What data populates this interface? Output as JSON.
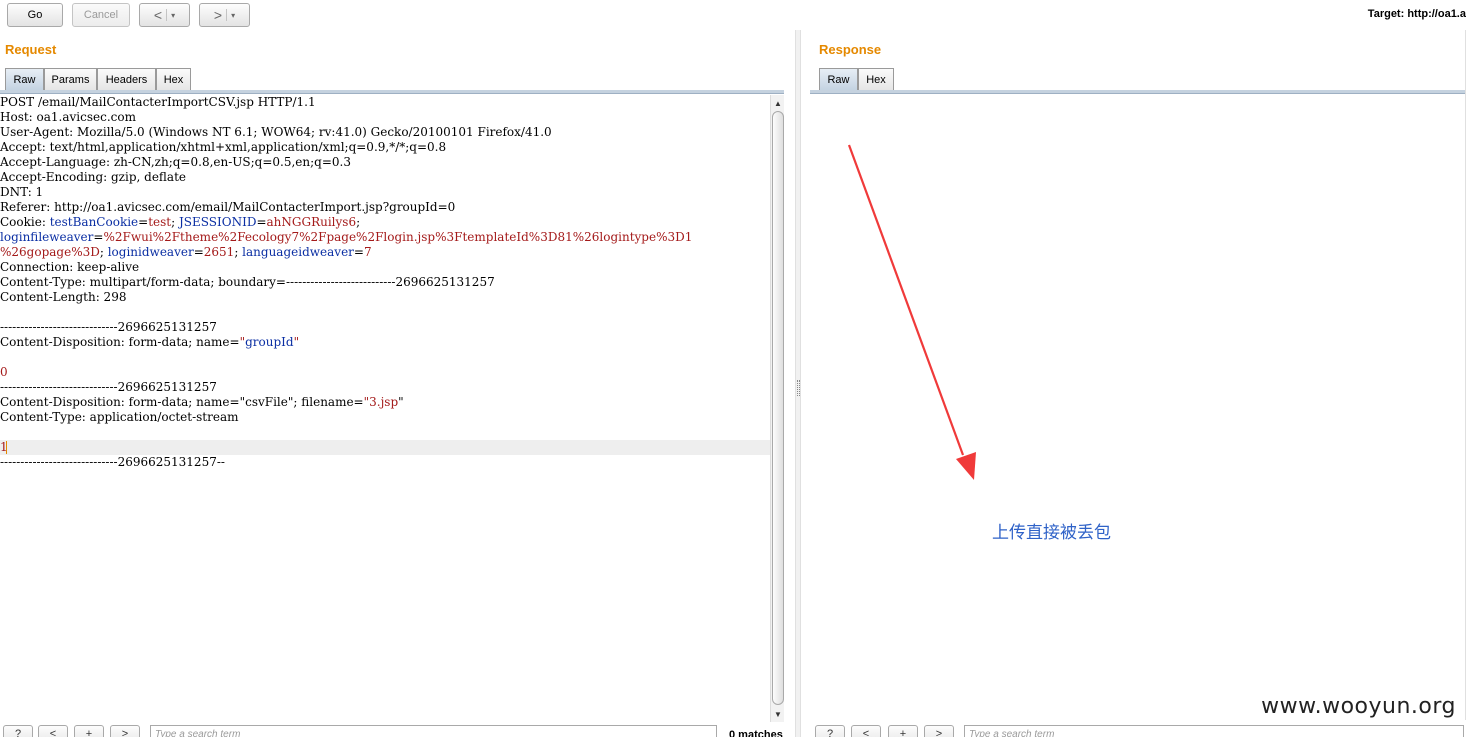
{
  "toolbar": {
    "go_label": "Go",
    "cancel_label": "Cancel",
    "back_glyph": "<",
    "forward_glyph": ">",
    "dropdown_glyph": "▾",
    "target_text": "Target: http://oa1.a"
  },
  "request": {
    "title": "Request",
    "tabs": [
      "Raw",
      "Params",
      "Headers",
      "Hex"
    ],
    "active_tab": "Raw",
    "lines": [
      [
        {
          "t": "POST /email/MailContacterImportCSV.jsp HTTP/1.1"
        }
      ],
      [
        {
          "t": "Host: oa1.avicsec.com"
        }
      ],
      [
        {
          "t": "User-Agent: Mozilla/5.0 (Windows NT 6.1; WOW64; rv:41.0) Gecko/20100101 Firefox/41.0"
        }
      ],
      [
        {
          "t": "Accept: text/html,application/xhtml+xml,application/xml;q=0.9,*/*;q=0.8"
        }
      ],
      [
        {
          "t": "Accept-Language: zh-CN,zh;q=0.8,en-US;q=0.5,en;q=0.3"
        }
      ],
      [
        {
          "t": "Accept-Encoding: gzip, deflate"
        }
      ],
      [
        {
          "t": "DNT: 1"
        }
      ],
      [
        {
          "t": "Referer: http://oa1.avicsec.com/email/MailContacterImport.jsp?groupId=0"
        }
      ],
      [
        {
          "t": "Cookie: "
        },
        {
          "t": "testBanCookie",
          "c": "k"
        },
        {
          "t": "="
        },
        {
          "t": "test",
          "c": "v"
        },
        {
          "t": "; "
        },
        {
          "t": "JSESSIONID",
          "c": "k"
        },
        {
          "t": "="
        },
        {
          "t": "ahNGGRuilys6",
          "c": "v"
        },
        {
          "t": ";"
        }
      ],
      [
        {
          "t": "loginfileweaver",
          "c": "k"
        },
        {
          "t": "="
        },
        {
          "t": "%2Fwui%2Ftheme%2Fecology7%2Fpage%2Flogin.jsp%3FtemplateId%3D81%26logintype%3D1",
          "c": "v"
        }
      ],
      [
        {
          "t": "%26gopage%3D",
          "c": "v"
        },
        {
          "t": "; "
        },
        {
          "t": "loginidweaver",
          "c": "k"
        },
        {
          "t": "="
        },
        {
          "t": "2651",
          "c": "v"
        },
        {
          "t": "; "
        },
        {
          "t": "languageidweaver",
          "c": "k"
        },
        {
          "t": "="
        },
        {
          "t": "7",
          "c": "v"
        }
      ],
      [
        {
          "t": "Connection: keep-alive"
        }
      ],
      [
        {
          "t": "Content-Type: multipart/form-data; boundary=---------------------------2696625131257"
        }
      ],
      [
        {
          "t": "Content-Length: 298"
        }
      ],
      [
        {
          "t": ""
        }
      ],
      [
        {
          "t": "-----------------------------2696625131257"
        }
      ],
      [
        {
          "t": "Content-Disposition: form-data; name="
        },
        {
          "t": "\"",
          "c": "v"
        },
        {
          "t": "groupId",
          "c": "k"
        },
        {
          "t": "\"",
          "c": "v"
        }
      ],
      [
        {
          "t": ""
        }
      ],
      [
        {
          "t": "0",
          "c": "v"
        }
      ],
      [
        {
          "t": "-----------------------------2696625131257"
        }
      ],
      [
        {
          "t": "Content-Disposition: form-data; name="
        },
        {
          "t": "\"csvFile\""
        },
        {
          "t": "; filename="
        },
        {
          "t": "\"",
          "c": "v"
        },
        {
          "t": "3.jsp",
          "c": "v"
        },
        {
          "t": "\""
        }
      ],
      [
        {
          "t": "Content-Type: application/octet-stream"
        }
      ],
      [
        {
          "t": ""
        }
      ],
      [
        {
          "t": "1",
          "c": "v"
        }
      ],
      [
        {
          "t": "-----------------------------2696625131257--"
        }
      ]
    ],
    "search": {
      "help_label": "?",
      "prev_label": "<",
      "add_label": "+",
      "next_label": ">",
      "placeholder": "Type a search term",
      "matches": "0 matches"
    }
  },
  "response": {
    "title": "Response",
    "tabs": [
      "Raw",
      "Hex"
    ],
    "active_tab": "Raw",
    "annotation": "上传直接被丢包",
    "search": {
      "help_label": "?",
      "prev_label": "<",
      "add_label": "+",
      "next_label": ">",
      "placeholder": "Type a search term"
    }
  },
  "watermark": "www.wooyun.org",
  "colors": {
    "heading": "#e58900",
    "param_name": "#0a2ea3",
    "param_value": "#a41a1a",
    "annotation": "#2f62c8",
    "arrow": "#f03a3a"
  }
}
